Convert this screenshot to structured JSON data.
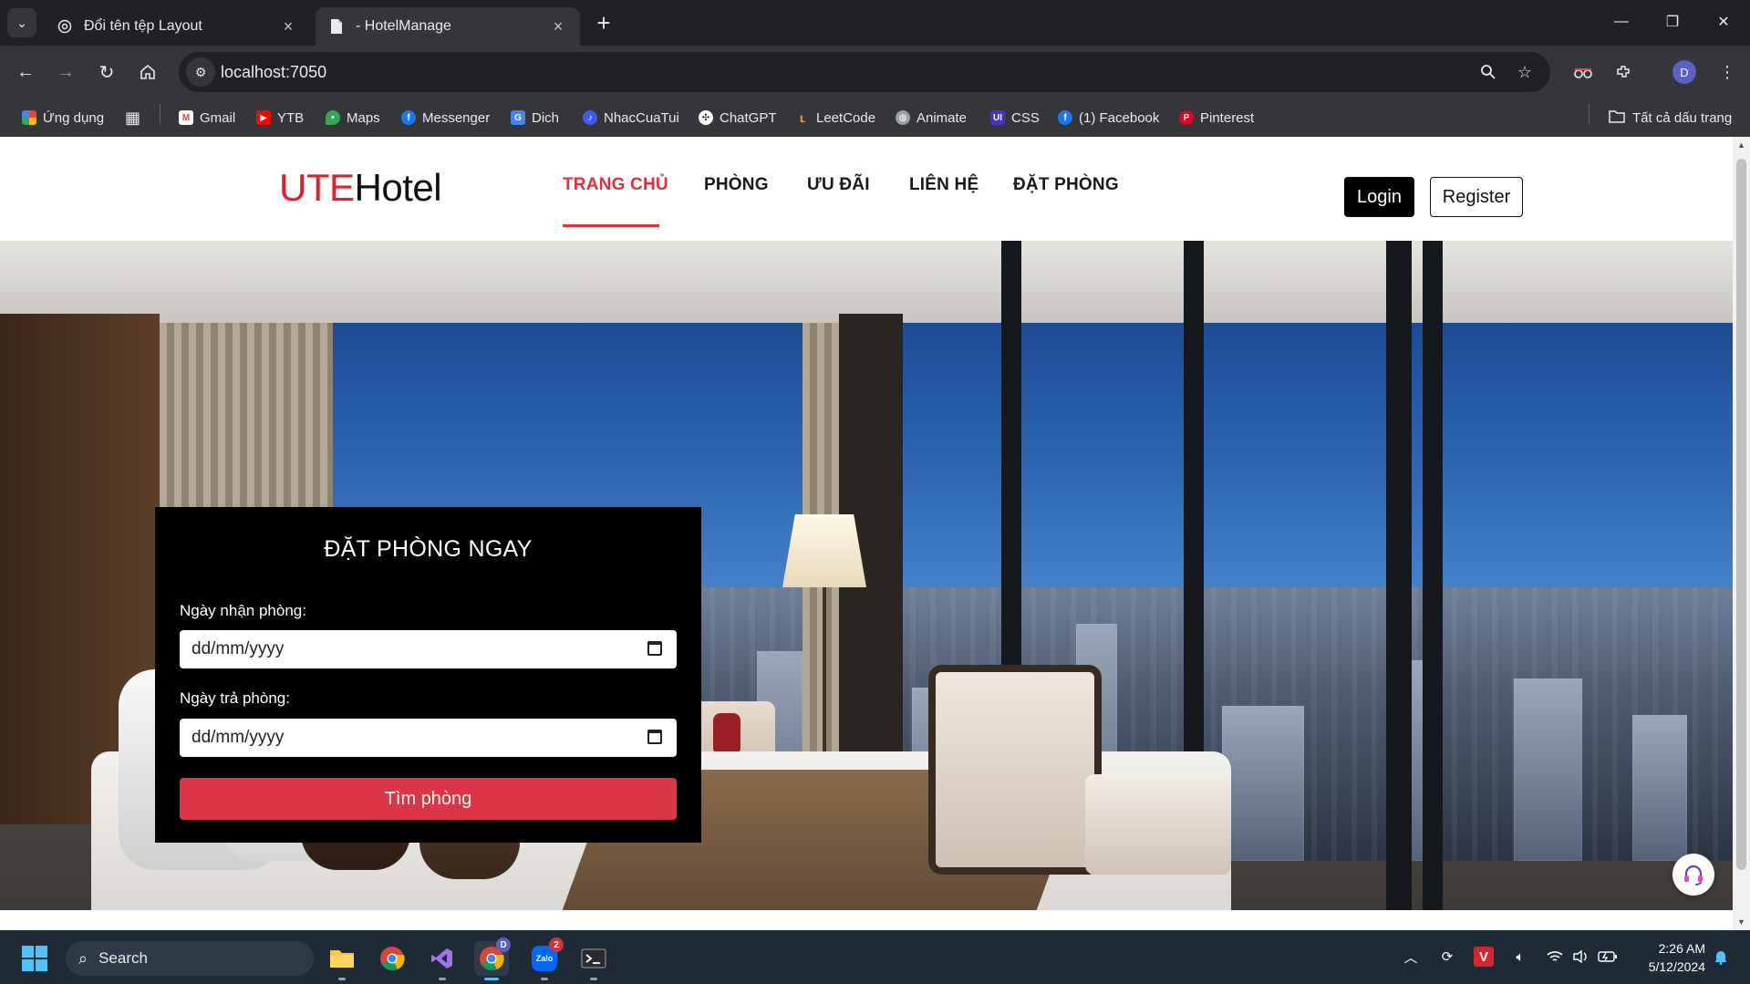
{
  "browser": {
    "tabs": [
      {
        "title": "Đổi tên tệp Layout",
        "icon": "chatgpt-icon"
      },
      {
        "title": "- HotelManage",
        "icon": "page-icon"
      }
    ],
    "url": "localhost:7050",
    "bookmarks": [
      {
        "label": "Ứng dụng",
        "icon": "apps-icon",
        "color": "#ea4335"
      },
      {
        "label": "Gmail",
        "icon": "gmail-icon",
        "color": "#ea4335"
      },
      {
        "label": "YTB",
        "icon": "youtube-icon",
        "color": "#ff0000"
      },
      {
        "label": "Maps",
        "icon": "maps-icon",
        "color": "#34a853"
      },
      {
        "label": "Messenger",
        "icon": "facebook-icon",
        "color": "#1877f2"
      },
      {
        "label": "Dich",
        "icon": "translate-icon",
        "color": "#4285f4"
      },
      {
        "label": "NhacCuaTui",
        "icon": "nhaccuatui-icon",
        "color": "#3d5afe"
      },
      {
        "label": "ChatGPT",
        "icon": "chatgpt-icon",
        "color": "#202124"
      },
      {
        "label": "LeetCode",
        "icon": "leetcode-icon",
        "color": "#ffa116"
      },
      {
        "label": "Animate",
        "icon": "globe-icon",
        "color": "#5f6368"
      },
      {
        "label": "CSS",
        "icon": "ui-icon",
        "color": "#4b2fbd"
      },
      {
        "label": "(1) Facebook",
        "icon": "facebook-icon",
        "color": "#1877f2"
      },
      {
        "label": "Pinterest",
        "icon": "pinterest-icon",
        "color": "#e60023"
      }
    ],
    "all_bookmarks": "Tất cả dấu trang",
    "profile_initial": "D"
  },
  "site": {
    "logo_ute": "UTE",
    "logo_hotel": "Hotel",
    "menu": [
      "TRANG CHỦ",
      "PHÒNG",
      "ƯU ĐÃI",
      "LIÊN HỆ",
      "ĐẶT PHÒNG"
    ],
    "active_menu": "TRANG CHỦ",
    "login": "Login",
    "register": "Register",
    "accent": "#e4303b"
  },
  "booking": {
    "title": "ĐẶT PHÒNG NGAY",
    "checkin_label": "Ngày nhận phòng:",
    "checkin_value": "dd/mm/yyyy",
    "checkout_label": "Ngày trả phòng:",
    "checkout_value": "dd/mm/yyyy",
    "search_button": "Tìm phòng",
    "button_color": "#dc3545"
  },
  "taskbar": {
    "search": "Search",
    "zalo_badge": "2",
    "chrome_badge": "D",
    "time": "2:26 AM",
    "date": "5/12/2024"
  }
}
